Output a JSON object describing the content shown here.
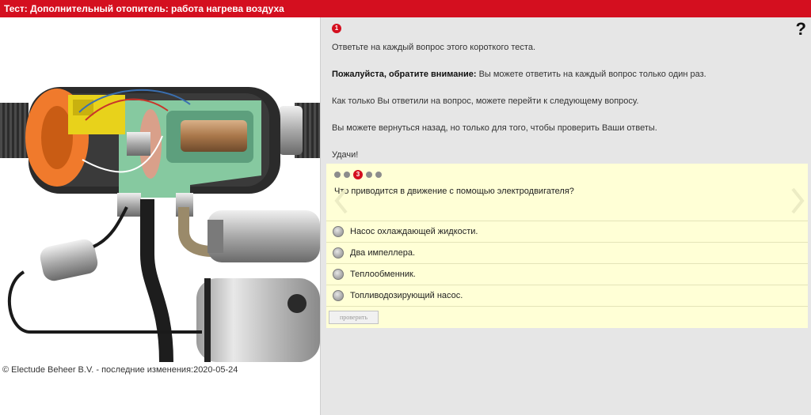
{
  "window": {
    "title": "Тест: Дополнительный отопитель: работа нагрева воздуха"
  },
  "left": {
    "copyright": "© Electude Beheer B.V. - последние изменения:2020-05-24"
  },
  "right": {
    "step_number": "1",
    "help_symbol": "?",
    "intro": {
      "line1": "Ответьте на каждый вопрос этого короткого теста.",
      "notice_bold": "Пожалуйста, обратите внимание:",
      "notice_text": " Вы можете ответить на каждый вопрос только один раз.",
      "line3": "Как только Вы ответили на вопрос, можете перейти к следующему вопросу.",
      "line4": "Вы можете вернуться назад, но только для того, чтобы проверить Ваши ответы.",
      "line5": "Удачи!"
    }
  },
  "quiz": {
    "current_question": "3",
    "question": "Что приводится в движение с помощью электродвигателя?",
    "answers": [
      {
        "label": "Насос охлаждающей жидкости."
      },
      {
        "label": "Два импеллера."
      },
      {
        "label": "Теплообменник."
      },
      {
        "label": "Топливодозирующий насос."
      }
    ],
    "check_button": "проверить"
  }
}
